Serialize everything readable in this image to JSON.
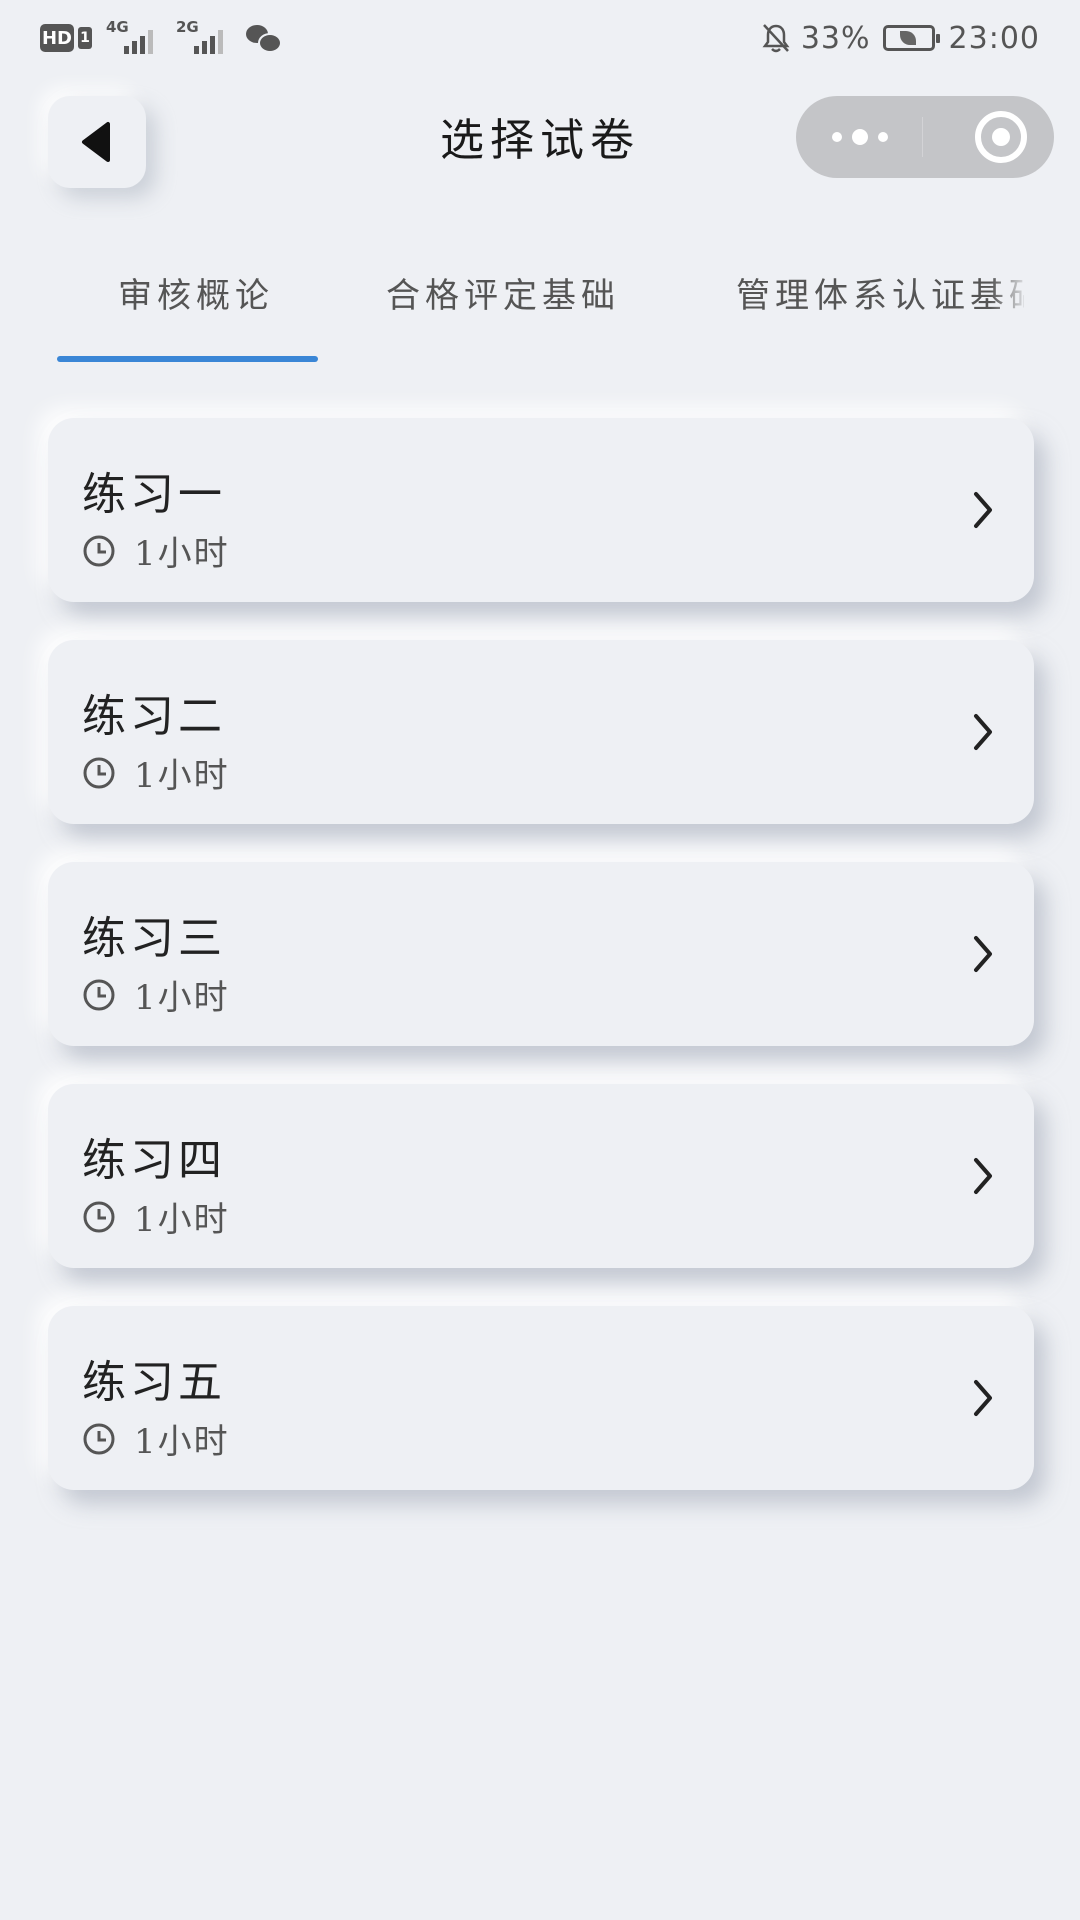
{
  "status_bar": {
    "hd": "HD",
    "sim": "1",
    "net1": "4G",
    "net2": "2G",
    "battery_percent": "33%",
    "time": "23:00"
  },
  "nav": {
    "title": "选择试卷"
  },
  "tabs": [
    {
      "label": "审核概论",
      "active": true
    },
    {
      "label": "合格评定基础",
      "active": false
    },
    {
      "label": "管理体系认证基础",
      "active": false
    }
  ],
  "exams": [
    {
      "title": "练习一",
      "duration": "1小时"
    },
    {
      "title": "练习二",
      "duration": "1小时"
    },
    {
      "title": "练习三",
      "duration": "1小时"
    },
    {
      "title": "练习四",
      "duration": "1小时"
    },
    {
      "title": "练习五",
      "duration": "1小时"
    }
  ],
  "colors": {
    "background": "#eef0f4",
    "accent": "#3a86d6",
    "capsule": "#c4c5c8"
  }
}
